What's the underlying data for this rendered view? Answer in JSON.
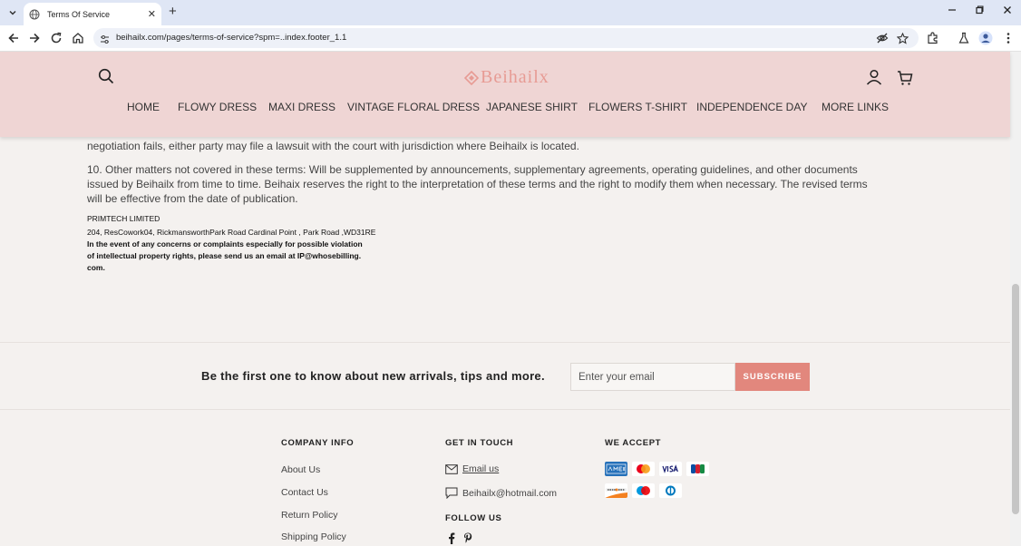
{
  "browser": {
    "tab_title": "Terms Of Service",
    "url": "beihailx.com/pages/terms-of-service?spm=..index.footer_1.1",
    "new_tab_label": "+",
    "close_tab_label": "✕"
  },
  "header": {
    "logo_text": "Beihailx",
    "nav": [
      {
        "label": "HOME"
      },
      {
        "label": "FLOWY DRESS"
      },
      {
        "label": "MAXI DRESS"
      },
      {
        "label": "VINTAGE FLORAL DRESS"
      },
      {
        "label": "JAPANESE SHIRT"
      },
      {
        "label": "FLOWERS T-SHIRT"
      },
      {
        "label": "INDEPENDENCE DAY"
      },
      {
        "label": "MORE LINKS"
      }
    ]
  },
  "content": {
    "paragraph9_tail": "negotiation fails, either party may file a lawsuit with the court with jurisdiction where Beihailx is located.",
    "paragraph10_line1": "10. Other matters not covered in these terms: Will be supplemented by announcements, supplementary agreements, operating guidelines, and other documents",
    "paragraph10_line2": "issued by Beihailx from time to time. Beihaix reserves the right to the interpretation of these terms and the right to modify them when necessary. The revised terms",
    "paragraph10_line3": "will be effective from the date of publication.",
    "company_name": "PRIMTECH LIMITED",
    "company_address": "204, ResCowork04, RickmansworthPark Road Cardinal Point , Park Road ,WD31RE",
    "concern_line1": "In the event of any concerns or complaints especially for possible violation",
    "concern_line2": "of intellectual property rights, please send us an email at IP@whosebilling.",
    "concern_line3": "com."
  },
  "newsletter": {
    "text": "Be the first one to know about new arrivals, tips and more.",
    "placeholder": "Enter your email",
    "button": "SUBSCRIBE"
  },
  "footer": {
    "company_info": {
      "heading": "COMPANY INFO",
      "links": [
        "About Us",
        "Contact Us",
        "Return Policy",
        "Shipping Policy"
      ]
    },
    "get_in_touch": {
      "heading": "GET IN TOUCH",
      "email_label": "Email us",
      "email_address": "Beihailx@hotmail.com"
    },
    "follow_us": {
      "heading": "FOLLOW US",
      "icons": [
        "facebook-icon",
        "pinterest-icon"
      ]
    },
    "we_accept": {
      "heading": "WE ACCEPT",
      "cards": [
        "amex",
        "mastercard",
        "visa",
        "jcb",
        "discover",
        "maestro",
        "diners-club"
      ]
    }
  },
  "colors": {
    "header_bg": "#efd5d4",
    "page_bg": "#f4f1ef",
    "logo": "#e79b94",
    "subscribe_button": "#e2877d"
  }
}
